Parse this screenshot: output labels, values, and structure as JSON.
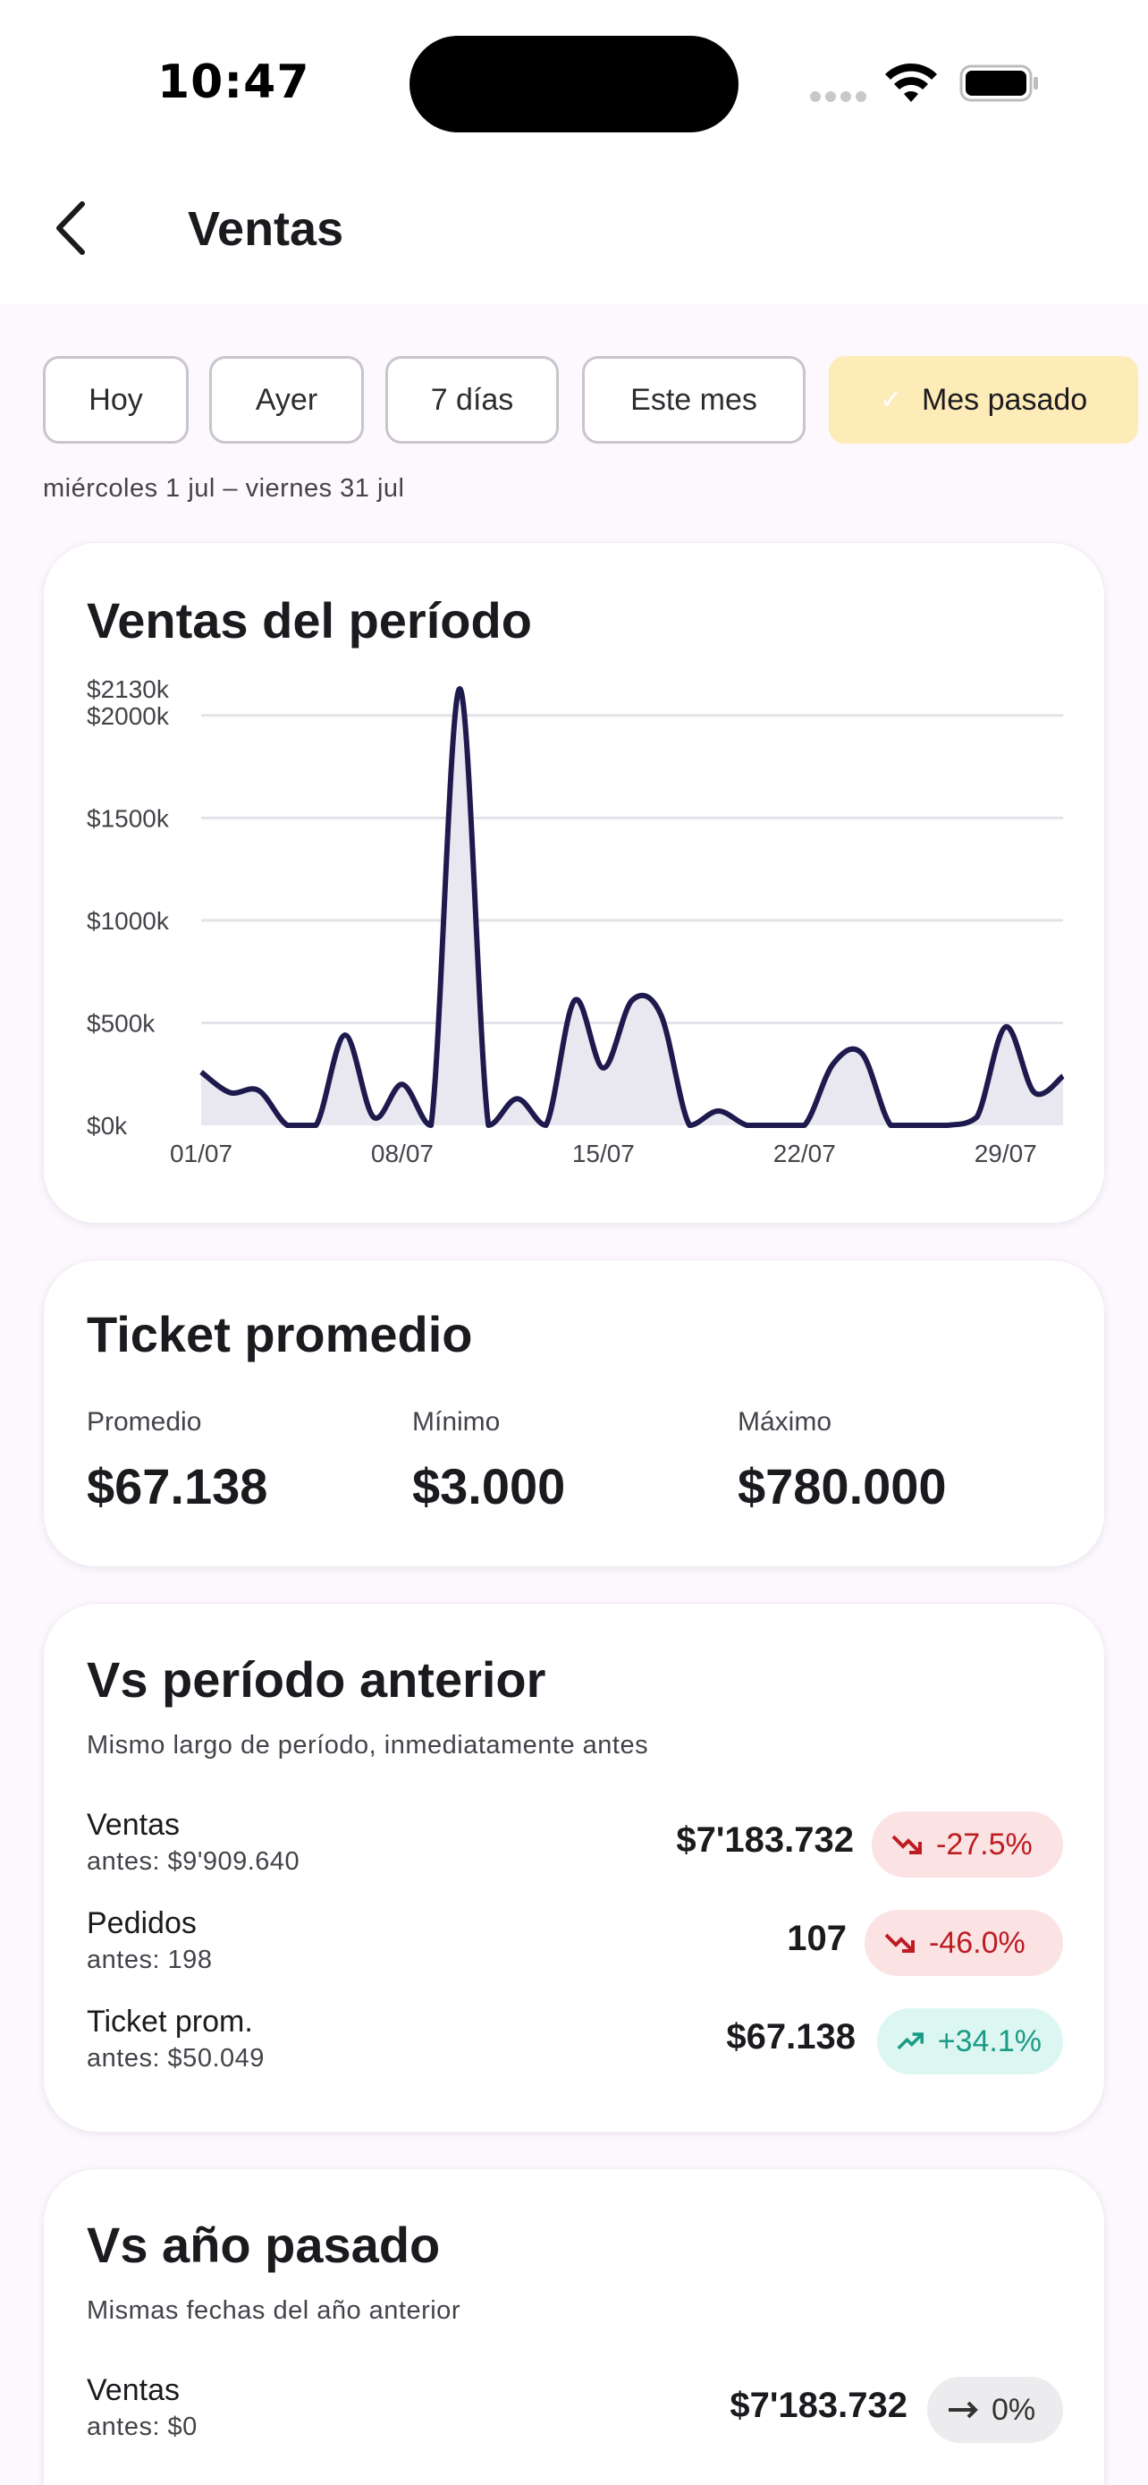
{
  "status_bar": {
    "time": "10:47"
  },
  "header": {
    "title": "Ventas"
  },
  "filters": {
    "chips": [
      "Hoy",
      "Ayer",
      "7 días",
      "Este mes",
      "Mes pasado"
    ],
    "selected": "Mes pasado",
    "range_label": "miércoles 1 jul – viernes 31 jul"
  },
  "sales_card": {
    "title": "Ventas del período"
  },
  "chart_data": {
    "type": "area",
    "title": "Ventas del período",
    "x": [
      "01/07",
      "02/07",
      "03/07",
      "04/07",
      "05/07",
      "06/07",
      "07/07",
      "08/07",
      "09/07",
      "10/07",
      "11/07",
      "12/07",
      "13/07",
      "14/07",
      "15/07",
      "16/07",
      "17/07",
      "18/07",
      "19/07",
      "20/07",
      "21/07",
      "22/07",
      "23/07",
      "24/07",
      "25/07",
      "26/07",
      "27/07",
      "28/07",
      "29/07",
      "30/07",
      "31/07"
    ],
    "values": [
      260,
      160,
      170,
      0,
      0,
      440,
      40,
      200,
      0,
      2130,
      0,
      130,
      0,
      610,
      280,
      610,
      540,
      0,
      70,
      0,
      0,
      0,
      300,
      350,
      0,
      0,
      0,
      40,
      480,
      160,
      240
    ],
    "xticks": [
      "01/07",
      "08/07",
      "15/07",
      "22/07",
      "29/07"
    ],
    "yticks": [
      "$0k",
      "$500k",
      "$1000k",
      "$1500k",
      "$2000k",
      "$2130k"
    ],
    "ylim": [
      0,
      2130
    ],
    "grid": true,
    "line_color": "#1e1a4d",
    "fill_color": "#e9e7ef"
  },
  "ticket_card": {
    "title": "Ticket promedio",
    "stats": [
      {
        "label": "Promedio",
        "value": "$67.138"
      },
      {
        "label": "Mínimo",
        "value": "$3.000"
      },
      {
        "label": "Máximo",
        "value": "$780.000"
      }
    ]
  },
  "prev_period_card": {
    "title": "Vs período anterior",
    "subtitle": "Mismo largo de período, inmediatamente antes",
    "rows": [
      {
        "name": "Ventas",
        "before": "antes: $9'909.640",
        "value": "$7'183.732",
        "change": "-27.5%",
        "trend": "down"
      },
      {
        "name": "Pedidos",
        "before": "antes: 198",
        "value": "107",
        "change": "-46.0%",
        "trend": "down"
      },
      {
        "name": "Ticket prom.",
        "before": "antes: $50.049",
        "value": "$67.138",
        "change": "+34.1%",
        "trend": "up"
      }
    ]
  },
  "last_year_card": {
    "title": "Vs año pasado",
    "subtitle": "Mismas fechas del año anterior",
    "rows": [
      {
        "name": "Ventas",
        "before": "antes: $0",
        "value": "$7'183.732",
        "change": "0%",
        "trend": "flat"
      }
    ]
  },
  "colors": {
    "accent_chip": "#fdebb8",
    "down": "#bd1d22",
    "up": "#1b9b85"
  }
}
